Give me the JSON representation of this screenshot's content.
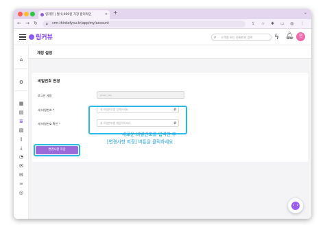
{
  "browser": {
    "tab_title": "링커뷰 | 월 9,900원 가장 합리적인",
    "tab_close": "×",
    "new_tab": "+",
    "url": "crm.thinkofyou.kr/app/my/account",
    "tab_list_icon": "chevron-down-icon"
  },
  "header": {
    "logo_text": "링커뷰",
    "search_placeholder": "고객명 또는 전화번호 검색",
    "avatar_initial": "현"
  },
  "page": {
    "title": "계정 설정"
  },
  "form": {
    "section_title": "비밀번호 변경",
    "login_id_label": "로그인 계정",
    "login_id_value": "phon_ibk",
    "new_password_label": "새 비밀번호 *",
    "new_password_placeholder": "새 비밀번호를 입력하세요.",
    "confirm_password_label": "새 비밀번호 확인 *",
    "confirm_password_placeholder": "새 비밀번호를 재입력하세요.",
    "save_button": "변경사항 저장"
  },
  "callout": {
    "line1": "새로운 비밀번호를 입력한 후",
    "line2": "[변경사항 저장] 버튼을 클릭하세요"
  },
  "colors": {
    "accent": "#7c3aed",
    "button": "#9b6bd9",
    "highlight": "#27b9e8",
    "avatar": "#f06bae"
  }
}
